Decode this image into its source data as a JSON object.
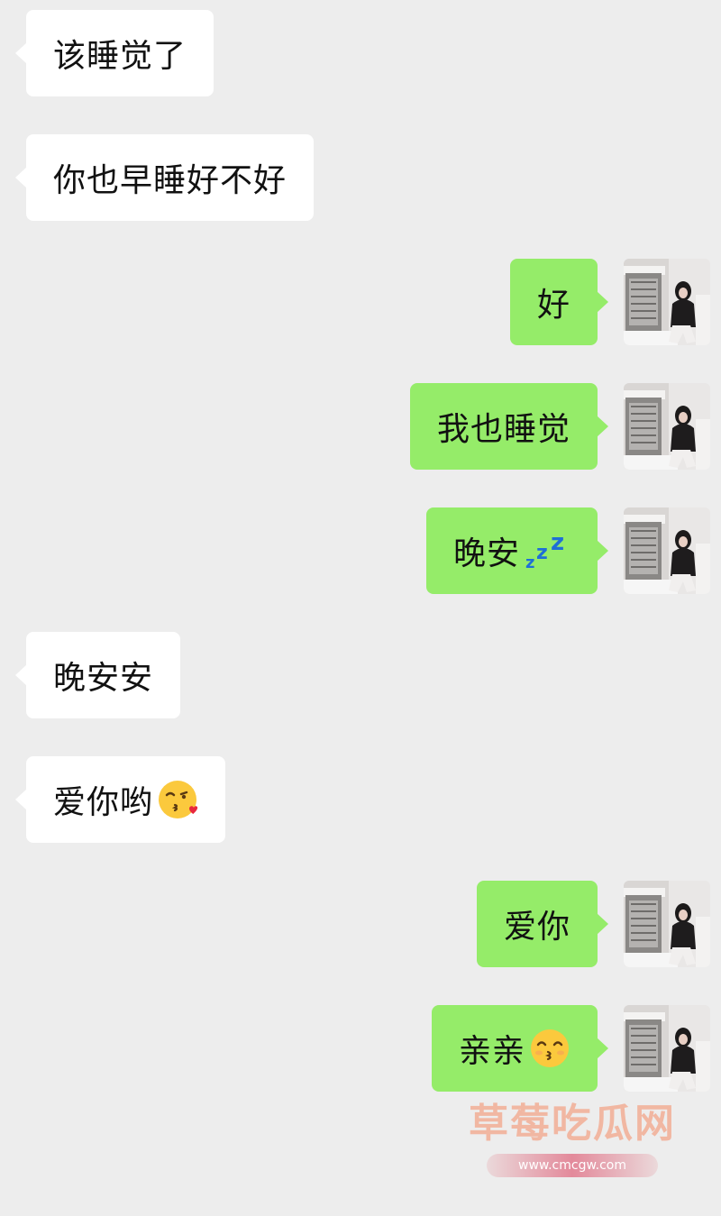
{
  "messages": [
    {
      "side": "left",
      "text": "该睡觉了"
    },
    {
      "side": "left",
      "text": "你也早睡好不好"
    },
    {
      "side": "right",
      "text": "好"
    },
    {
      "side": "right",
      "text": "我也睡觉"
    },
    {
      "side": "right",
      "text": "晚安",
      "emoji": "zzz-sleep-emoji"
    },
    {
      "side": "left",
      "text": "晚安安"
    },
    {
      "side": "left",
      "text": "爱你哟",
      "emoji": "kissing-heart-emoji"
    },
    {
      "side": "right",
      "text": "爱你"
    },
    {
      "side": "right",
      "text": "亲亲",
      "emoji": "kissing-smiling-eyes-emoji"
    }
  ],
  "colors": {
    "background": "#ededed",
    "incoming_bubble": "#ffffff",
    "outgoing_bubble": "#95ec69"
  },
  "watermark": {
    "title": "草莓吃瓜网",
    "url": "www.cmcgw.com"
  }
}
